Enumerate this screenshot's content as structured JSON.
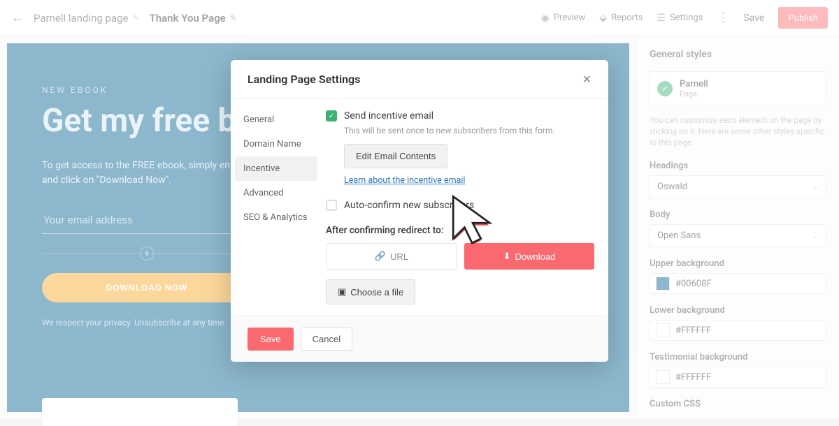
{
  "header": {
    "breadcrumb1": "Parnell landing page",
    "breadcrumb2": "Thank You Page",
    "preview": "Preview",
    "reports": "Reports",
    "settings": "Settings",
    "save": "Save",
    "publish": "Publish"
  },
  "hero": {
    "eyebrow": "NEW EBOOK",
    "headline": "Get my free book now!",
    "subtext": "To get access to the FREE ebook, simply enter your email and click on \"Download Now\".",
    "email_placeholder": "Your email address",
    "download_btn": "DOWNLOAD NOW",
    "privacy": "We respect your privacy. Unsubscribe at any time."
  },
  "sidebar": {
    "title": "General styles",
    "page_name": "Parnell",
    "page_type": "Page",
    "help": "You can customize each element on the page by clicking on it. Here are some other styles specific to this page.",
    "headings_label": "Headings",
    "headings_value": "Oswald",
    "body_label": "Body",
    "body_value": "Open Sans",
    "upper_bg_label": "Upper background",
    "upper_bg_value": "#00608F",
    "lower_bg_label": "Lower background",
    "lower_bg_value": "#FFFFFF",
    "testimonial_bg_label": "Testimonial background",
    "testimonial_bg_value": "#FFFFFF",
    "custom_css_label": "Custom CSS",
    "colors": {
      "upper": "#00608F",
      "lower": "#FFFFFF",
      "testimonial": "#FFFFFF"
    }
  },
  "modal": {
    "title": "Landing Page Settings",
    "tabs": {
      "general": "General",
      "domain": "Domain Name",
      "incentive": "Incentive",
      "advanced": "Advanced",
      "seo": "SEO & Analytics"
    },
    "send_incentive_label": "Send incentive email",
    "send_incentive_hint": "This will be sent once to new subscribers from this form.",
    "edit_email_btn": "Edit Email Contents",
    "learn_link": "Learn about the incentive email",
    "auto_confirm_label": "Auto-confirm new subscribers",
    "redirect_label": "After confirming redirect to:",
    "url_btn": "URL",
    "download_btn": "Download",
    "choose_file_btn": "Choose a file",
    "save_btn": "Save",
    "cancel_btn": "Cancel"
  }
}
